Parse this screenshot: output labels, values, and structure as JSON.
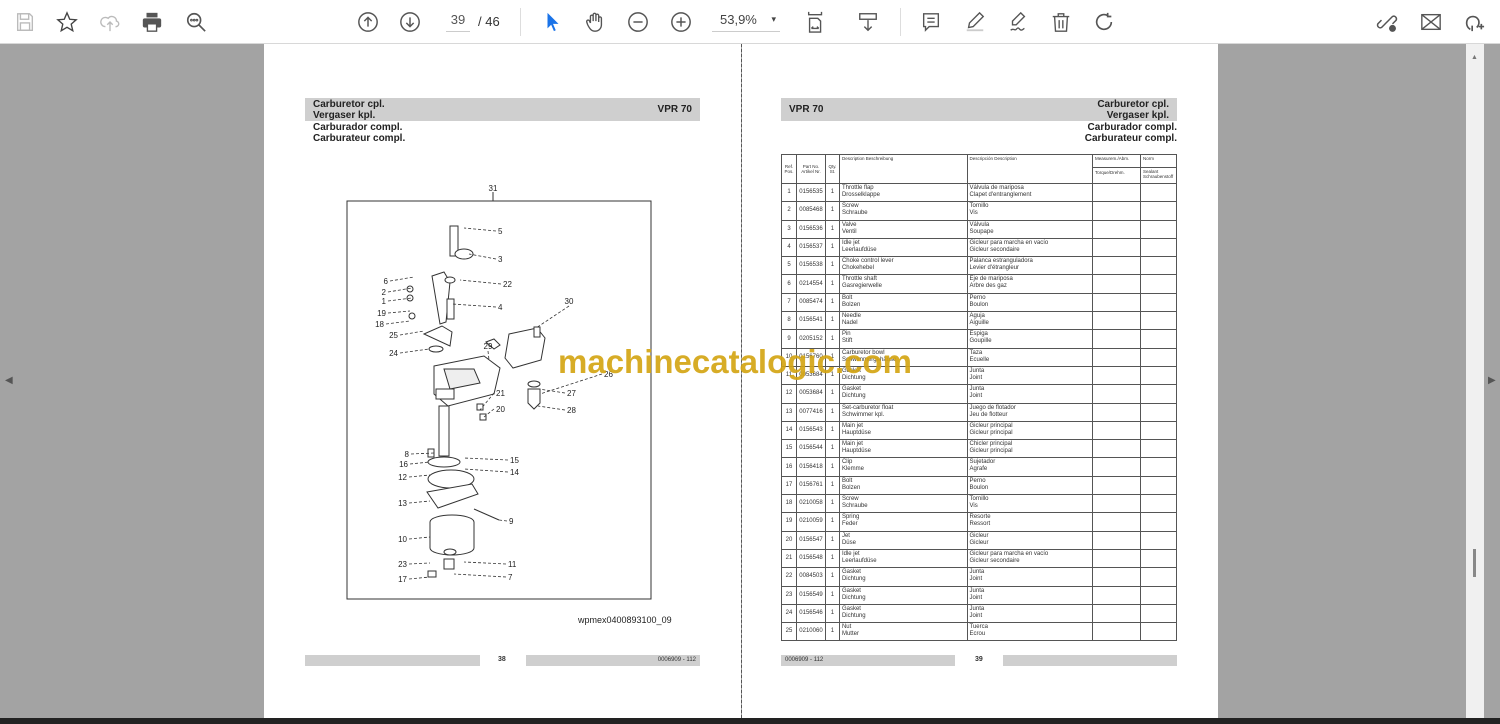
{
  "toolbar": {
    "page_current": "39",
    "page_total": "/ 46",
    "zoom": "53,9%",
    "zoom_caret": "▾",
    "icons": [
      "save-icon",
      "bookmark-star-icon",
      "upload-cloud-icon",
      "print-icon",
      "find-icon",
      "page-up-icon",
      "page-down-icon",
      "select-cursor-icon",
      "hand-icon",
      "zoom-out-icon",
      "zoom-in-icon",
      "fit-page-icon",
      "scroll-mode-icon",
      "comment-icon",
      "highlight-icon",
      "sign-icon",
      "delete-icon",
      "rotate-icon",
      "share-link-icon",
      "email-icon",
      "add-user-icon"
    ]
  },
  "left_page": {
    "header": {
      "line1": "Carburetor cpl.",
      "line2": "Vergaser kpl.",
      "line3": "Carburador compl.",
      "line4": "Carburateur compl.",
      "model": "VPR 70"
    },
    "diagram": {
      "labels": [
        "31",
        "5",
        "3",
        "22",
        "6",
        "2",
        "1",
        "4",
        "30",
        "19",
        "18",
        "25",
        "24",
        "29",
        "26",
        "21",
        "27",
        "20",
        "28",
        "8",
        "15",
        "16",
        "14",
        "12",
        "13",
        "9",
        "10",
        "23",
        "11",
        "17",
        "7"
      ],
      "caption": "wpmex0400893100_09"
    },
    "footer": {
      "page": "38",
      "code": "0006909 - 112"
    }
  },
  "right_page": {
    "header": {
      "line1": "Carburetor cpl.",
      "line2": "Vergaser kpl.",
      "line3": "Carburador compl.",
      "line4": "Carburateur compl.",
      "model": "VPR 70"
    },
    "table": {
      "headers": {
        "ref": "Ref. Pos.",
        "part": "Part No. Artikel Nr.",
        "qty": "Qty. St.",
        "desc": "Description Beschreibung",
        "descr2": "Descripción Description",
        "measure": "Measurem./Abm.",
        "torque": "Torque/Drehm.",
        "norm": "Norm",
        "sealant": "Sealant Schraubenstoff"
      },
      "rows": [
        [
          "1",
          "0156535",
          "1",
          "Throttle flap",
          "Drosselklappe",
          "Válvula de mariposa",
          "Clapet d'entranglement"
        ],
        [
          "2",
          "0085468",
          "1",
          "Screw",
          "Schraube",
          "Tornillo",
          "Vis"
        ],
        [
          "3",
          "0156536",
          "1",
          "Valve",
          "Ventil",
          "Válvula",
          "Soupape"
        ],
        [
          "4",
          "0156537",
          "1",
          "Idle jet",
          "Leerlaufdüse",
          "Gicleur para marcha en vacío",
          "Gicleur secondaire"
        ],
        [
          "5",
          "0156538",
          "1",
          "Choke control lever",
          "Chokehebel",
          "Palanca estranguladora",
          "Levier d'étrangleur"
        ],
        [
          "6",
          "0214554",
          "1",
          "Throttle shaft",
          "Gasregierwelle",
          "Eje de mariposa",
          "Arbre des gaz"
        ],
        [
          "7",
          "0085474",
          "1",
          "Bolt",
          "Bolzen",
          "Perno",
          "Boulon"
        ],
        [
          "8",
          "0156541",
          "1",
          "Needle",
          "Nadel",
          "Aguja",
          "Aiguille"
        ],
        [
          "9",
          "0205152",
          "1",
          "Pin",
          "Stift",
          "Espiga",
          "Goupille"
        ],
        [
          "10",
          "0156760",
          "1",
          "Carburetor bowl",
          "Schwimmergehäuse",
          "Taza",
          "Ecuelle"
        ],
        [
          "11",
          "0053684",
          "1",
          "Gasket",
          "Dichtung",
          "Junta",
          "Joint"
        ],
        [
          "12",
          "0053684",
          "1",
          "Gasket",
          "Dichtung",
          "Junta",
          "Joint"
        ],
        [
          "13",
          "0077416",
          "1",
          "Set-carburetor float",
          "Schwimmer kpl.",
          "Juego de flotador",
          "Jeu de flotteur"
        ],
        [
          "14",
          "0156543",
          "1",
          "Main jet",
          "Hauptdüse",
          "Gicleur principal",
          "Gicleur principal"
        ],
        [
          "15",
          "0156544",
          "1",
          "Main jet",
          "Hauptdüse",
          "Chicler principal",
          "Gicleur principal"
        ],
        [
          "16",
          "0156418",
          "1",
          "Clip",
          "Klemme",
          "Sujetador",
          "Agrafe"
        ],
        [
          "17",
          "0156761",
          "1",
          "Bolt",
          "Bolzen",
          "Perno",
          "Boulon"
        ],
        [
          "18",
          "0210058",
          "1",
          "Screw",
          "Schraube",
          "Tornillo",
          "Vis"
        ],
        [
          "19",
          "0210059",
          "1",
          "Spring",
          "Feder",
          "Resorte",
          "Ressort"
        ],
        [
          "20",
          "0156547",
          "1",
          "Jet",
          "Düse",
          "Gicleur",
          "Gicleur"
        ],
        [
          "21",
          "0156548",
          "1",
          "Idle jet",
          "Leerlaufdüse",
          "Gicleur para marcha en vacío",
          "Gicleur secondaire"
        ],
        [
          "22",
          "0084503",
          "1",
          "Gasket",
          "Dichtung",
          "Junta",
          "Joint"
        ],
        [
          "23",
          "0156549",
          "1",
          "Gasket",
          "Dichtung",
          "Junta",
          "Joint"
        ],
        [
          "24",
          "0156546",
          "1",
          "Gasket",
          "Dichtung",
          "Junta",
          "Joint"
        ],
        [
          "25",
          "0210060",
          "1",
          "Nut",
          "Mutter",
          "Tuerca",
          "Ecrou"
        ]
      ]
    },
    "footer": {
      "page": "39",
      "code": "0006909 - 112"
    }
  },
  "watermark": "machinecatalogic.com",
  "nav": {
    "prev": "◀",
    "next": "▶"
  }
}
